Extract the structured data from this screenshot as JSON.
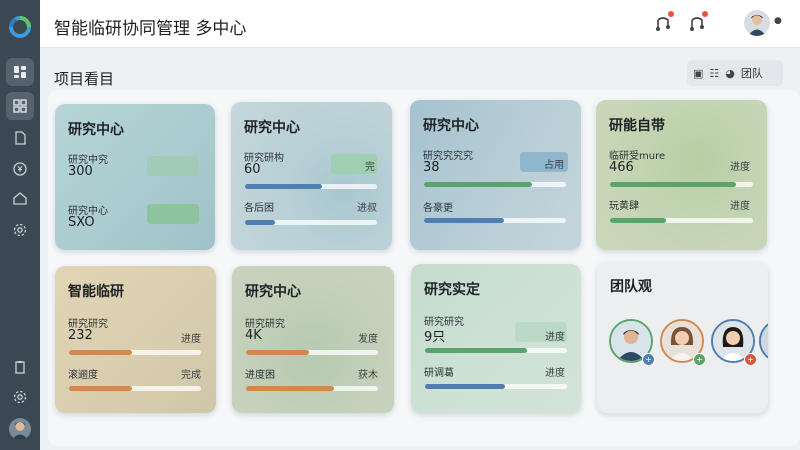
{
  "header": {
    "title": "智能临研协同管理 多中心"
  },
  "page": {
    "section_title": "项目看目"
  },
  "toolbar": {
    "label": "团队"
  },
  "cards": [
    {
      "title": "研究中心",
      "metric1_label": "研究中究",
      "metric1_value": "300",
      "metric2_label": "研究中心",
      "metric2_value": "SXO"
    },
    {
      "title": "研究中心",
      "metric1_label": "研究研构",
      "metric1_value": "60",
      "metric1_tag": "完",
      "metric2_label": "各后困",
      "metric2_tag": "进叔",
      "progress": [
        0.58,
        0.23
      ]
    },
    {
      "title": "研究中心",
      "metric1_label": "研究究究究",
      "metric1_value": "38",
      "metric1_tag": "占用",
      "metric2_label": "各豪更",
      "progress": [
        0.76,
        0.56
      ]
    },
    {
      "title": "研能自带",
      "metric1_label": "临研受mure",
      "metric1_value": "466",
      "metric1_tag": "进度",
      "metric2_label": "玩黄肆",
      "metric2_tag": "进度",
      "progress": [
        0.88,
        0.39
      ]
    },
    {
      "title": "智能临研",
      "metric1_label": "研究研究",
      "metric1_value": "232",
      "metric1_tag": "进度",
      "metric2_label": "滚逦度",
      "metric2_tag": "完成",
      "progress": [
        0.48,
        0.48
      ]
    },
    {
      "title": "研究中心",
      "metric1_label": "研究研究",
      "metric1_value": "4K",
      "metric1_tag": "发度",
      "metric2_label": "进度困",
      "metric2_tag": "获木",
      "progress": [
        0.48,
        0.67
      ]
    },
    {
      "title": "研究实定",
      "metric1_label": "研究研究",
      "metric1_value": "9只",
      "metric1_tag": "进度",
      "metric2_label": "研调葛",
      "metric2_tag": "进度",
      "progress": [
        0.72,
        0.56
      ]
    }
  ],
  "team": {
    "title": "团队观"
  },
  "colors": {
    "sidebar": "#3b4753",
    "accent_green": "#5aa36d",
    "accent_blue": "#4e7fb0",
    "accent_orange": "#d08a4d"
  },
  "icons": [
    "logo-icon",
    "dashboard-icon",
    "projects-icon",
    "document-icon",
    "finance-icon",
    "home-icon",
    "settings-icon",
    "clipboard-icon",
    "gear-icon",
    "bell-icon",
    "message-icon"
  ]
}
